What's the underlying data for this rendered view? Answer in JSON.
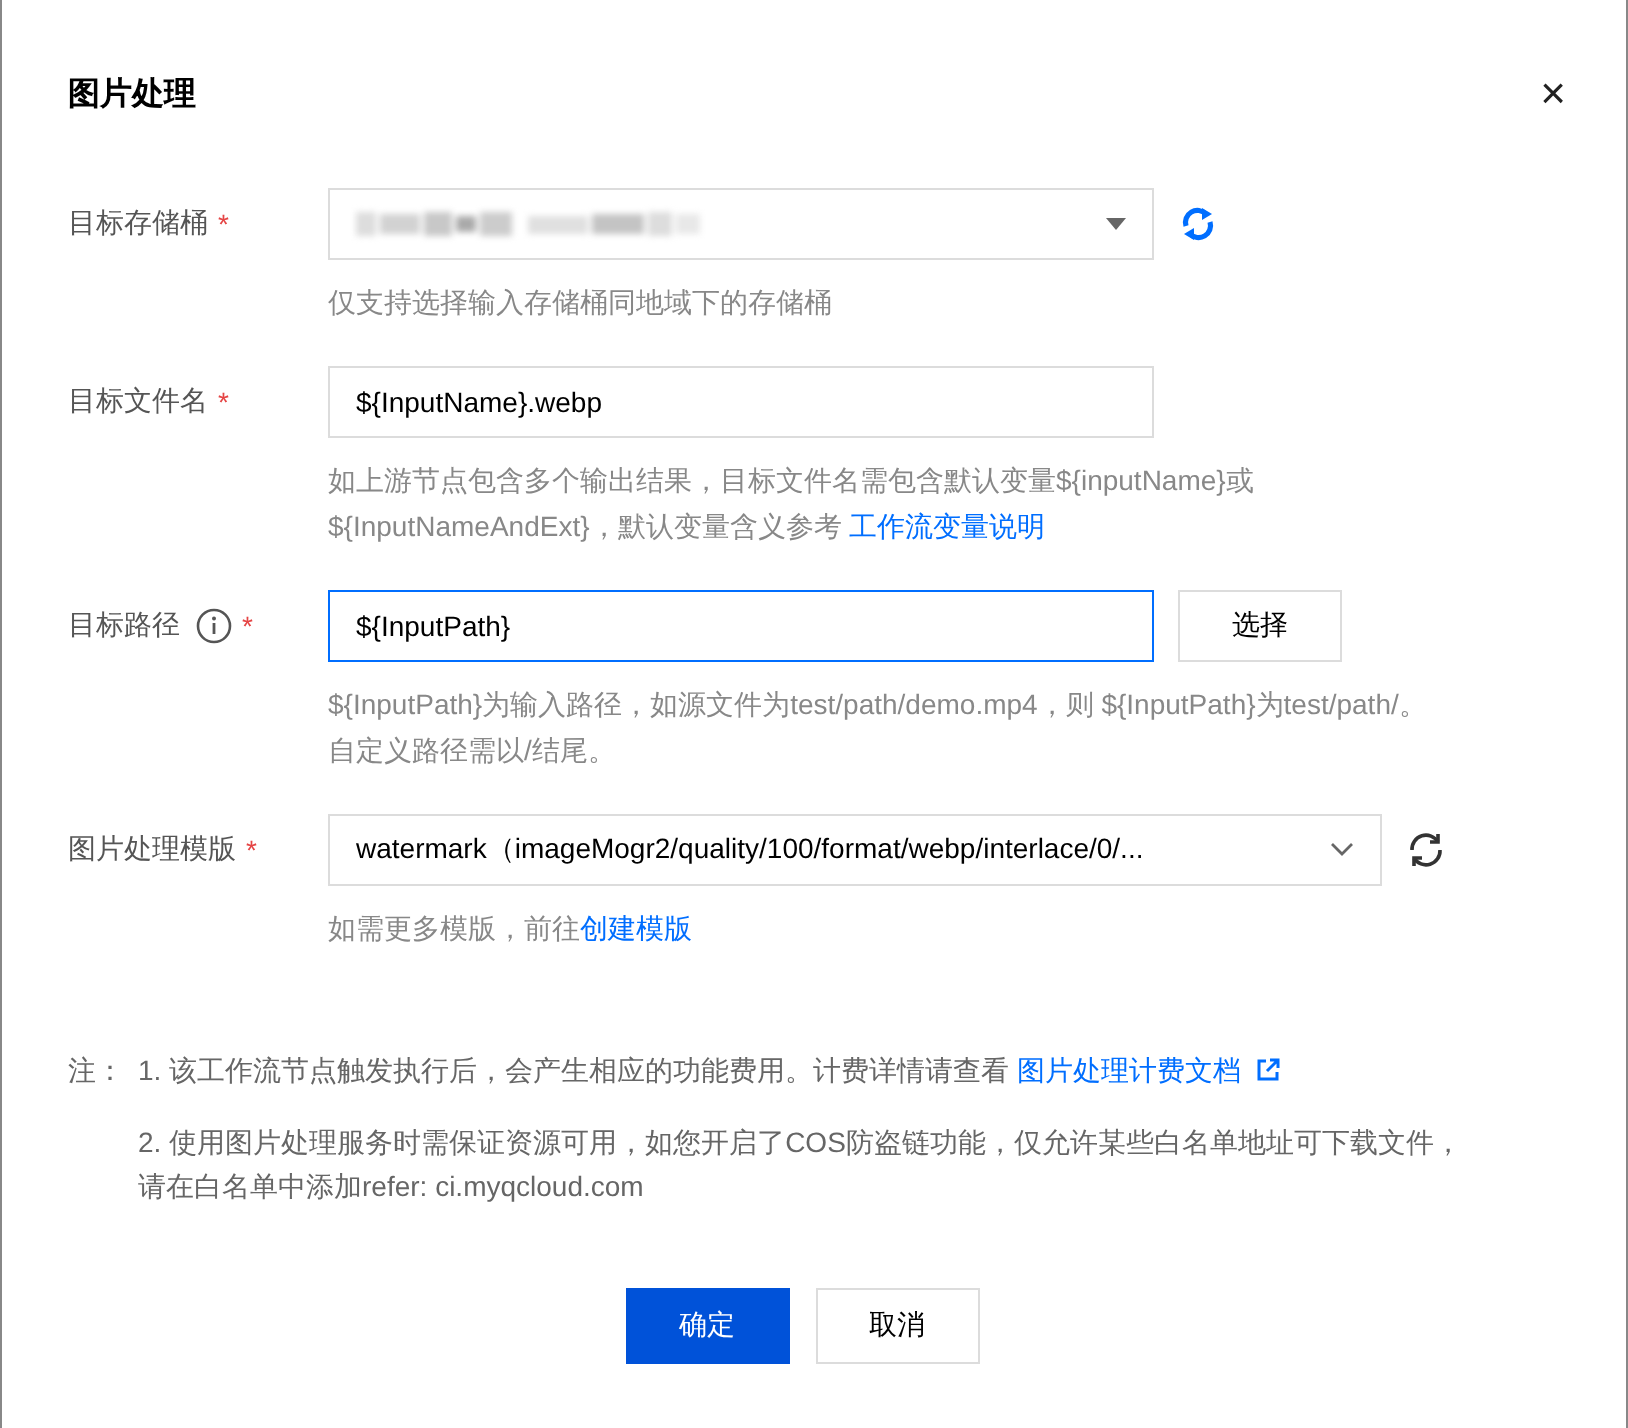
{
  "dialog": {
    "title": "图片处理",
    "close": "×"
  },
  "fields": [
    {
      "kind": "blurred-select",
      "label": "目标存储桶",
      "required": "*",
      "info": false,
      "focused": false,
      "refresh": {
        "highlighted": true
      },
      "help": [
        {
          "text": "仅支持选择输入存储桶同地域下的存储桶"
        }
      ]
    },
    {
      "kind": "input",
      "label": "目标文件名",
      "required": "*",
      "info": false,
      "focused": false,
      "value": "${InputName}.webp",
      "help": [
        {
          "text": "如上游节点包含多个输出结果，目标文件名需包含默认变量${inputName}或"
        },
        {
          "text": "${InputNameAndExt}，默认变量含义参考 ",
          "link": "工作流变量说明"
        }
      ]
    },
    {
      "kind": "input",
      "label": "目标路径",
      "required": "*",
      "info": true,
      "focused": true,
      "value": "${InputPath}",
      "button": "选择",
      "help": [
        {
          "text": "${InputPath}为输入路径，如源文件为test/path/demo.mp4，则 ${InputPath}为test/path/。"
        },
        {
          "text": "自定义路径需以/结尾。"
        }
      ]
    },
    {
      "kind": "select",
      "label": "图片处理模版",
      "required": "*",
      "info": false,
      "focused": false,
      "value": "watermark（imageMogr2/quality/100/format/webp/interlace/0/...",
      "refresh": {
        "highlighted": false
      },
      "help": [
        {
          "text": "如需更多模版，前往",
          "link": "创建模版"
        }
      ]
    }
  ],
  "notes": {
    "label": "注：",
    "items": [
      {
        "lines": [
          "1. 该工作流节点触发执行后，会产生相应的功能费用。计费详情请查看 "
        ],
        "link": "图片处理计费文档",
        "external": true
      },
      {
        "lines": [
          "2. 使用图片处理服务时需保证资源可用，如您开启了COS防盗链功能，仅允许某些白名单地址可下载文件，",
          "请在白名单中添加refer: ci.myqcloud.com"
        ],
        "external": false
      }
    ]
  },
  "buttons": [
    {
      "label": "确定",
      "primary": true
    },
    {
      "label": "取消",
      "primary": false
    }
  ]
}
